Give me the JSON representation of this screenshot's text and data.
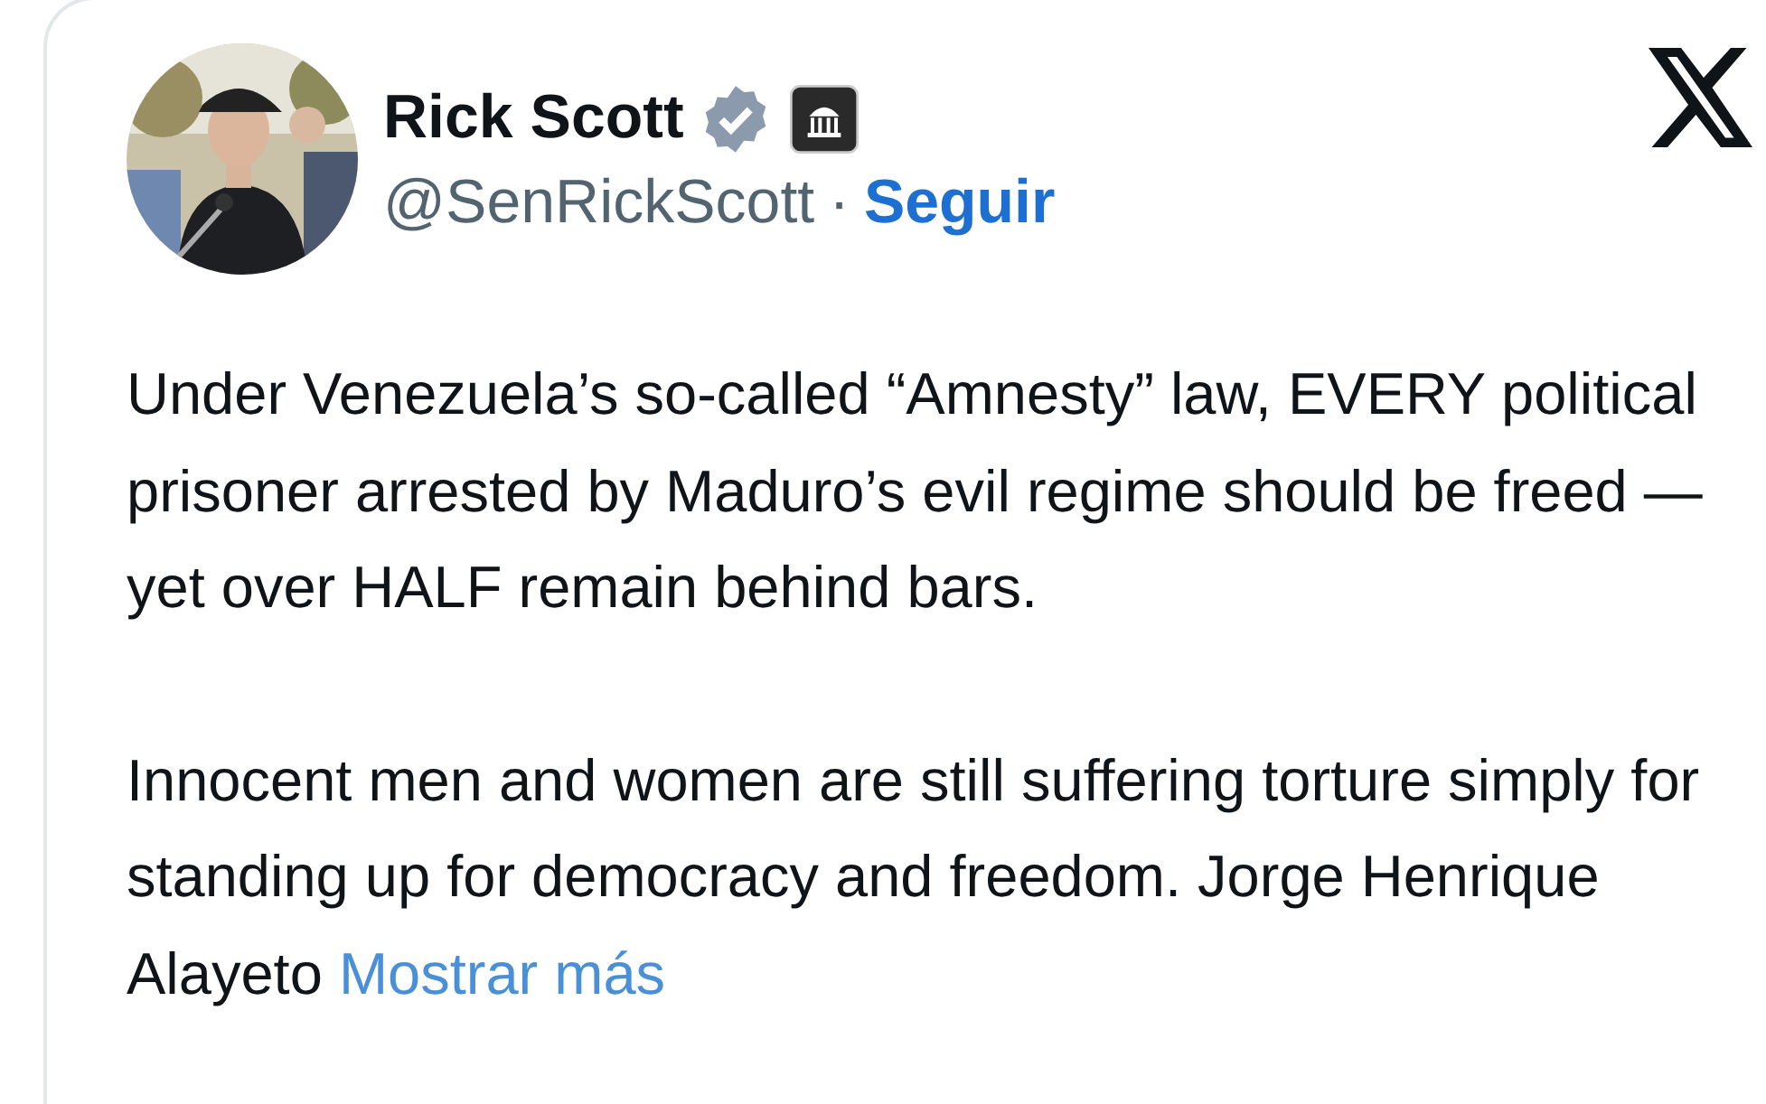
{
  "author": {
    "name": "Rick Scott",
    "verified": true,
    "handle": "@SenRickScott",
    "separator": "·",
    "follow": "Seguir"
  },
  "paragraphs": [
    {
      "text": "Under Venezuela’s so-called “Amnesty” law, EVERY political prisoner arrested by Maduro’s evil regime should be freed — yet over HALF remain behind bars."
    },
    {
      "text": "Innocent men and women are still suffering torture simply for standing up for democracy and freedom. Jorge Henrique Alayeto",
      "more": "Mostrar más"
    }
  ]
}
